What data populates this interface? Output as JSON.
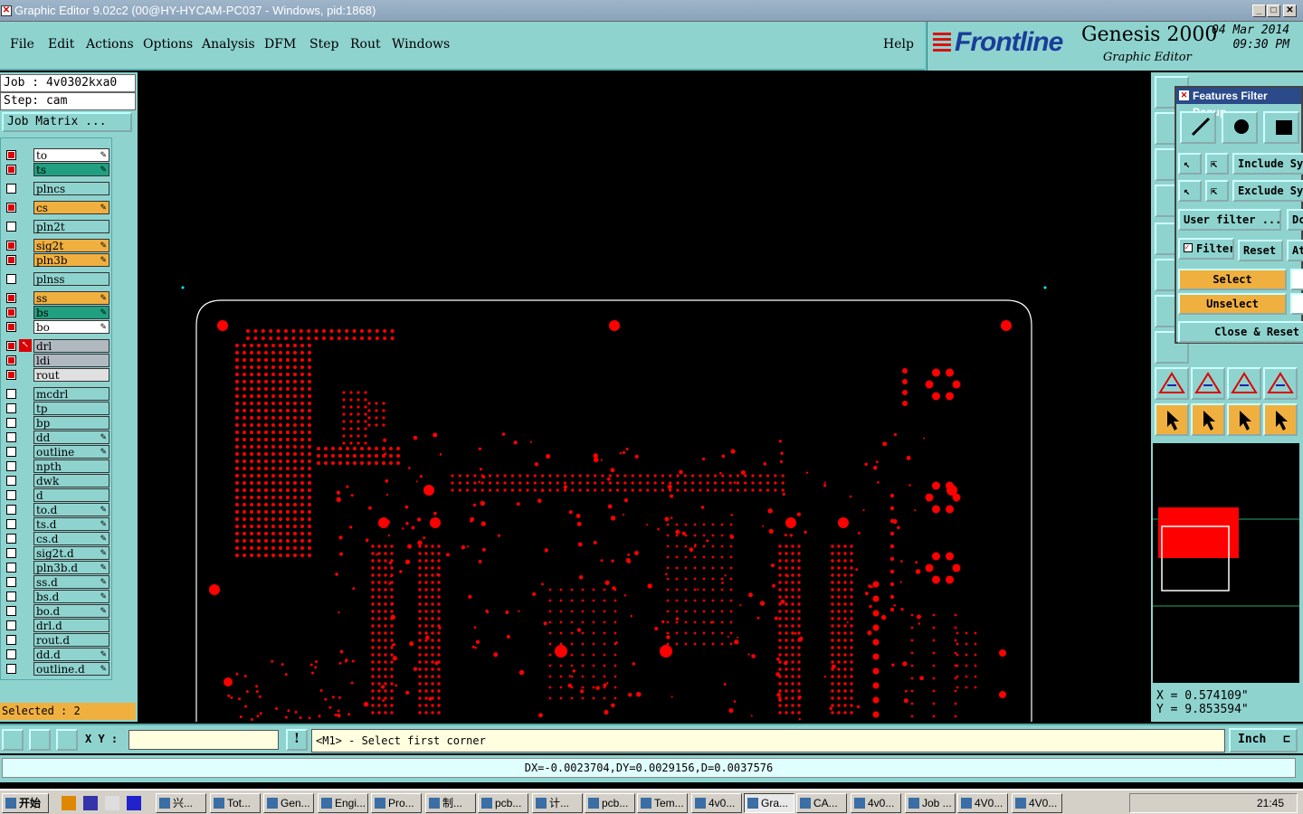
{
  "window": {
    "title": "Graphic Editor 9.02c2 (00@HY-HYCAM-PC037 - Windows, pid:1868)"
  },
  "menu": {
    "items": [
      "File",
      "Edit",
      "Actions",
      "Options",
      "Analysis",
      "DFM",
      "Step",
      "Rout",
      "Windows"
    ],
    "help": "Help"
  },
  "logo": {
    "brand": "Frontline",
    "product": "Genesis 2000",
    "subtitle": "Graphic Editor",
    "date": "04 Mar 2014",
    "time": "09:30 PM"
  },
  "job": {
    "job_label": "Job : 4v0302kxa0",
    "step_label": "Step: cam",
    "matrix_button": "Job Matrix ..."
  },
  "layers": [
    {
      "name": "to",
      "color": "#ffffff",
      "on": true,
      "pen": true
    },
    {
      "name": "ts",
      "color": "#20a080",
      "on": true,
      "pen": true
    },
    {
      "name": "plncs",
      "color": "#8fd3cf",
      "on": false,
      "pen": false
    },
    {
      "name": "cs",
      "color": "#f0b040",
      "on": true,
      "pen": true
    },
    {
      "name": "pln2t",
      "color": "#8fd3cf",
      "on": false,
      "pen": false
    },
    {
      "name": "sig2t",
      "color": "#f0b040",
      "on": true,
      "pen": true
    },
    {
      "name": "pln3b",
      "color": "#f0b040",
      "on": true,
      "pen": true
    },
    {
      "name": "plnss",
      "color": "#8fd3cf",
      "on": false,
      "pen": false
    },
    {
      "name": "ss",
      "color": "#f0b040",
      "on": true,
      "pen": true
    },
    {
      "name": "bs",
      "color": "#20a080",
      "on": true,
      "pen": true
    },
    {
      "name": "bo",
      "color": "#ffffff",
      "on": true,
      "pen": true
    },
    {
      "name": "drl",
      "color": "#b0b8c0",
      "on": true,
      "pen": false
    },
    {
      "name": "ldi",
      "color": "#b0b8c0",
      "on": true,
      "pen": false
    },
    {
      "name": "rout",
      "color": "#e0e0e0",
      "on": true,
      "pen": false
    },
    {
      "name": "mcdrl",
      "color": "#8fd3cf",
      "on": false,
      "pen": false
    },
    {
      "name": "tp",
      "color": "#8fd3cf",
      "on": false,
      "pen": false
    },
    {
      "name": "bp",
      "color": "#8fd3cf",
      "on": false,
      "pen": false
    },
    {
      "name": "dd",
      "color": "#8fd3cf",
      "on": false,
      "pen": true
    },
    {
      "name": "outline",
      "color": "#8fd3cf",
      "on": false,
      "pen": true
    },
    {
      "name": "npth",
      "color": "#8fd3cf",
      "on": false,
      "pen": false
    },
    {
      "name": "dwk",
      "color": "#8fd3cf",
      "on": false,
      "pen": false
    },
    {
      "name": "d",
      "color": "#8fd3cf",
      "on": false,
      "pen": false
    },
    {
      "name": "to.d",
      "color": "#8fd3cf",
      "on": false,
      "pen": true
    },
    {
      "name": "ts.d",
      "color": "#8fd3cf",
      "on": false,
      "pen": true
    },
    {
      "name": "cs.d",
      "color": "#8fd3cf",
      "on": false,
      "pen": true
    },
    {
      "name": "sig2t.d",
      "color": "#8fd3cf",
      "on": false,
      "pen": true
    },
    {
      "name": "pln3b.d",
      "color": "#8fd3cf",
      "on": false,
      "pen": true
    },
    {
      "name": "ss.d",
      "color": "#8fd3cf",
      "on": false,
      "pen": true
    },
    {
      "name": "bs.d",
      "color": "#8fd3cf",
      "on": false,
      "pen": true
    },
    {
      "name": "bo.d",
      "color": "#8fd3cf",
      "on": false,
      "pen": true
    },
    {
      "name": "drl.d",
      "color": "#8fd3cf",
      "on": false,
      "pen": false
    },
    {
      "name": "rout.d",
      "color": "#8fd3cf",
      "on": false,
      "pen": false
    },
    {
      "name": "dd.d",
      "color": "#8fd3cf",
      "on": false,
      "pen": true
    },
    {
      "name": "outline.d",
      "color": "#8fd3cf",
      "on": false,
      "pen": true
    }
  ],
  "selected": "Selected : 2",
  "filter_popup": {
    "title": "Features Filter Popup",
    "include": "Include Sym",
    "exclude": "Exclude Sym",
    "user_filter": "User filter ...",
    "dc": "Dc",
    "filter": "Filter",
    "reset": "Reset",
    "att": "Att",
    "select": "Select",
    "unselect": "Unselect",
    "close_reset": "Close & Reset"
  },
  "coords": {
    "x": "X = 0.574109\"",
    "y": "Y = 9.853594\""
  },
  "command": {
    "xy_label": "X Y :",
    "prompt": "<M1> - Select first corner",
    "unit": "Inch"
  },
  "status": "DX=-0.0023704,DY=0.0029156,D=0.0037576",
  "taskbar": {
    "start": "开始",
    "items": [
      "兴...",
      "Tot...",
      "Gen...",
      "Engi...",
      "Pro...",
      "制...",
      "pcb...",
      "计...",
      "pcb...",
      "Tem...",
      "4v0...",
      "Gra...",
      "CA...",
      "4v0...",
      "Job ...",
      "4V0...",
      "4V0..."
    ],
    "active_index": 11,
    "clock": "21:45"
  },
  "colors": {
    "panel": "#8fd3cf",
    "layer_red": "#ff0000",
    "accent_yellow": "#f0b040"
  }
}
